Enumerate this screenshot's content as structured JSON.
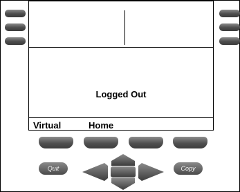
{
  "screen": {
    "status": "Logged Out",
    "softkeys": [
      "Virtual",
      "Home"
    ]
  },
  "buttons": {
    "quit_label": "Quit",
    "copy_label": "Copy"
  },
  "colors": {
    "key_dark": "#3a3a3a",
    "key_light": "#8a8a8a",
    "screen_bg": "#ffffff",
    "border": "#000000"
  }
}
